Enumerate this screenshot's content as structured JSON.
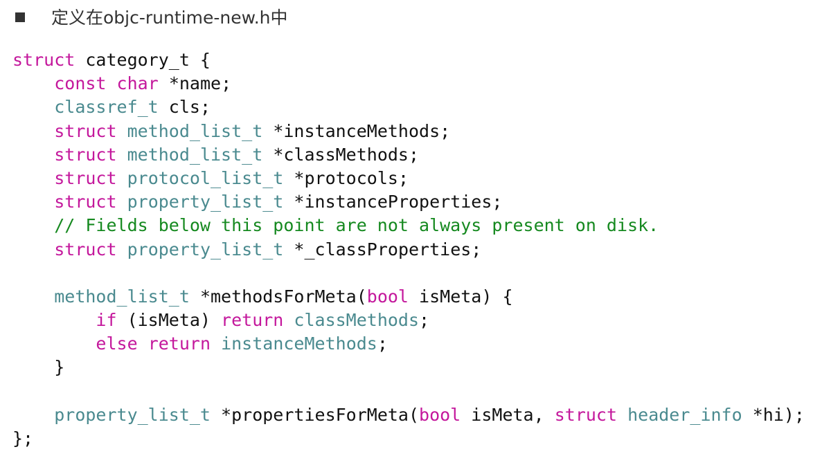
{
  "heading": {
    "text": "定义在objc-runtime-new.h中"
  },
  "code": {
    "language": "objective-c",
    "colors": {
      "keyword": "#c4189c",
      "type": "#4a8a8f",
      "comment": "#15891f",
      "text": "#111111"
    },
    "lines": [
      [
        {
          "k": "kw",
          "t": "struct"
        },
        {
          "k": "tx",
          "t": " category_t {"
        }
      ],
      [
        {
          "k": "tx",
          "t": "    "
        },
        {
          "k": "kw",
          "t": "const"
        },
        {
          "k": "tx",
          "t": " "
        },
        {
          "k": "kw",
          "t": "char"
        },
        {
          "k": "tx",
          "t": " *name;"
        }
      ],
      [
        {
          "k": "tx",
          "t": "    "
        },
        {
          "k": "ty",
          "t": "classref_t"
        },
        {
          "k": "tx",
          "t": " cls;"
        }
      ],
      [
        {
          "k": "tx",
          "t": "    "
        },
        {
          "k": "kw",
          "t": "struct"
        },
        {
          "k": "tx",
          "t": " "
        },
        {
          "k": "ty",
          "t": "method_list_t"
        },
        {
          "k": "tx",
          "t": " *instanceMethods;"
        }
      ],
      [
        {
          "k": "tx",
          "t": "    "
        },
        {
          "k": "kw",
          "t": "struct"
        },
        {
          "k": "tx",
          "t": " "
        },
        {
          "k": "ty",
          "t": "method_list_t"
        },
        {
          "k": "tx",
          "t": " *classMethods;"
        }
      ],
      [
        {
          "k": "tx",
          "t": "    "
        },
        {
          "k": "kw",
          "t": "struct"
        },
        {
          "k": "tx",
          "t": " "
        },
        {
          "k": "ty",
          "t": "protocol_list_t"
        },
        {
          "k": "tx",
          "t": " *protocols;"
        }
      ],
      [
        {
          "k": "tx",
          "t": "    "
        },
        {
          "k": "kw",
          "t": "struct"
        },
        {
          "k": "tx",
          "t": " "
        },
        {
          "k": "ty",
          "t": "property_list_t"
        },
        {
          "k": "tx",
          "t": " *instanceProperties;"
        }
      ],
      [
        {
          "k": "tx",
          "t": "    "
        },
        {
          "k": "cm",
          "t": "// Fields below this point are not always present on disk."
        }
      ],
      [
        {
          "k": "tx",
          "t": "    "
        },
        {
          "k": "kw",
          "t": "struct"
        },
        {
          "k": "tx",
          "t": " "
        },
        {
          "k": "ty",
          "t": "property_list_t"
        },
        {
          "k": "tx",
          "t": " *_classProperties;"
        }
      ],
      [],
      [
        {
          "k": "tx",
          "t": "    "
        },
        {
          "k": "ty",
          "t": "method_list_t"
        },
        {
          "k": "tx",
          "t": " *methodsForMeta("
        },
        {
          "k": "kw",
          "t": "bool"
        },
        {
          "k": "tx",
          "t": " isMeta) {"
        }
      ],
      [
        {
          "k": "tx",
          "t": "        "
        },
        {
          "k": "kw",
          "t": "if"
        },
        {
          "k": "tx",
          "t": " (isMeta) "
        },
        {
          "k": "kw",
          "t": "return"
        },
        {
          "k": "tx",
          "t": " "
        },
        {
          "k": "ty",
          "t": "classMethods"
        },
        {
          "k": "tx",
          "t": ";"
        }
      ],
      [
        {
          "k": "tx",
          "t": "        "
        },
        {
          "k": "kw",
          "t": "else"
        },
        {
          "k": "tx",
          "t": " "
        },
        {
          "k": "kw",
          "t": "return"
        },
        {
          "k": "tx",
          "t": " "
        },
        {
          "k": "ty",
          "t": "instanceMethods"
        },
        {
          "k": "tx",
          "t": ";"
        }
      ],
      [
        {
          "k": "tx",
          "t": "    }"
        }
      ],
      [],
      [
        {
          "k": "tx",
          "t": "    "
        },
        {
          "k": "ty",
          "t": "property_list_t"
        },
        {
          "k": "tx",
          "t": " *propertiesForMeta("
        },
        {
          "k": "kw",
          "t": "bool"
        },
        {
          "k": "tx",
          "t": " isMeta, "
        },
        {
          "k": "kw",
          "t": "struct"
        },
        {
          "k": "tx",
          "t": " "
        },
        {
          "k": "ty",
          "t": "header_info"
        },
        {
          "k": "tx",
          "t": " *hi);"
        }
      ],
      [
        {
          "k": "tx",
          "t": "};"
        }
      ]
    ]
  }
}
